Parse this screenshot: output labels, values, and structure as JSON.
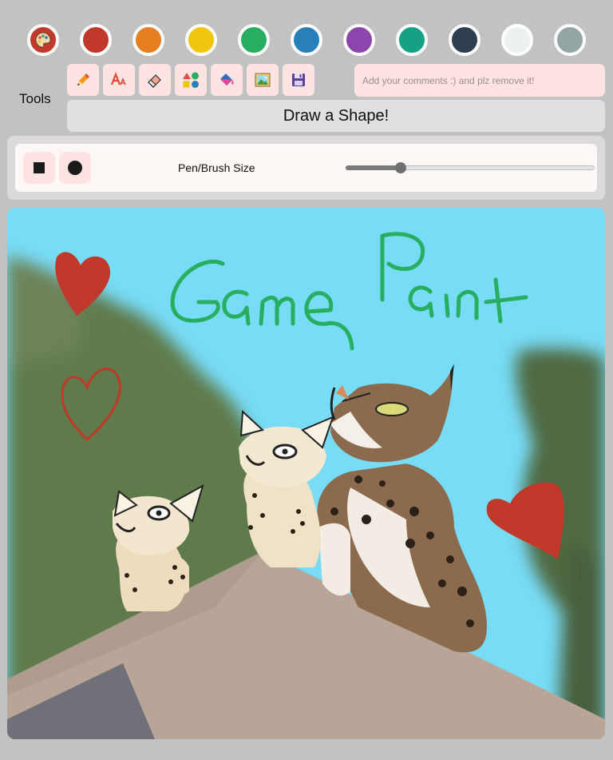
{
  "palette": {
    "picker_icon": "palette-icon",
    "colors": [
      "#c0392b",
      "#e67e22",
      "#f1c40f",
      "#27ae60",
      "#2980b9",
      "#8e44ad",
      "#16a085",
      "#2c3e50",
      "#ecf0f1",
      "#95a5a6"
    ]
  },
  "toolbar": {
    "label": "Tools",
    "tools": [
      {
        "name": "pencil-icon"
      },
      {
        "name": "text-icon"
      },
      {
        "name": "eraser-icon"
      },
      {
        "name": "shapes-icon"
      },
      {
        "name": "fill-bucket-icon"
      },
      {
        "name": "image-icon"
      },
      {
        "name": "save-icon"
      }
    ],
    "shape_button": "Draw a Shape!"
  },
  "comment": {
    "placeholder": "Add your comments :) and plz remove it!"
  },
  "brush": {
    "label": "Pen/Brush Size",
    "shapes": [
      "square-brush-icon",
      "circle-brush-icon"
    ],
    "size_fraction": 0.22
  },
  "canvas": {
    "background_color": "#78dcf7",
    "heart_color": "#c0392b",
    "text_color": "#27ae60"
  }
}
